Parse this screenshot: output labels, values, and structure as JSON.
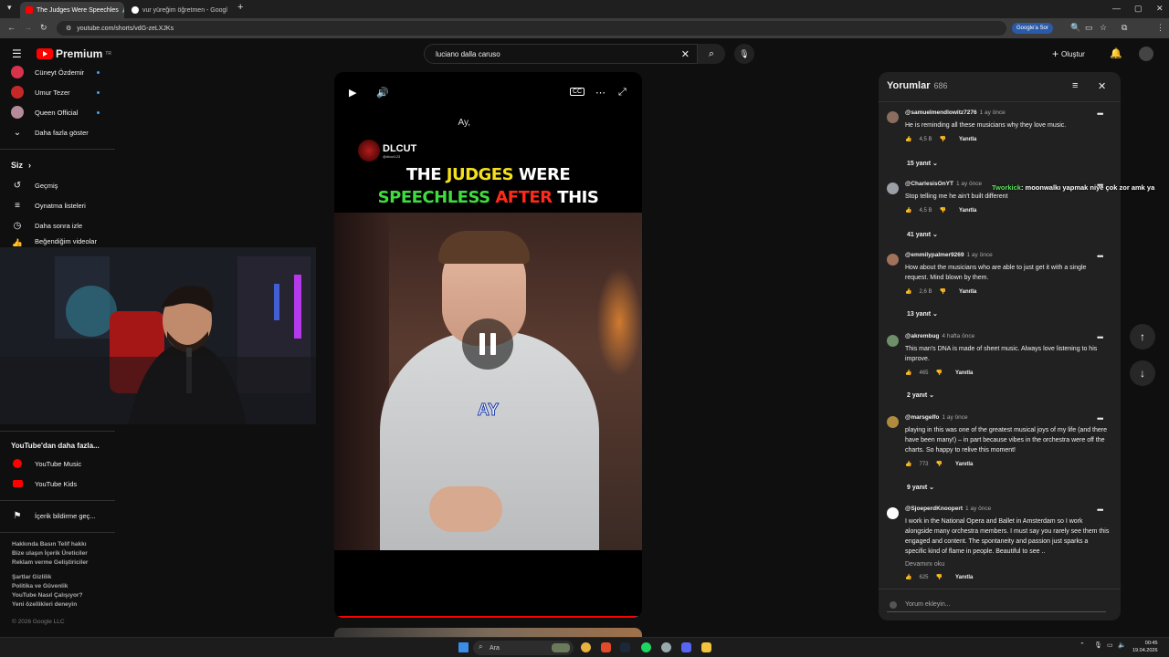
{
  "browser": {
    "tabs": [
      {
        "title": "The Judges Were Speechles",
        "active": true
      },
      {
        "title": "vur yüreğim öğretmen - Googl",
        "active": false
      }
    ],
    "url": "youtube.com/shorts/vdG-zeLXJKs",
    "google_ask": "Google'a Sor",
    "profile_letter": "B"
  },
  "header": {
    "logo_text": "Premium",
    "logo_sup": "TR",
    "search_value": "luciano dalla caruso",
    "create_label": "Oluştur"
  },
  "sidebar": {
    "subscriptions": [
      {
        "label": "Cüneyt Özdemir",
        "color": "#d6334c"
      },
      {
        "label": "Umur Tezer",
        "color": "#c62828"
      },
      {
        "label": "Queen Official",
        "color": "#b58a9a"
      }
    ],
    "show_more": "Daha fazla göster",
    "you_section": "Siz",
    "you_items": [
      "Geçmiş",
      "Oynatma listeleri",
      "Daha sonra izle",
      "Beğendiğim videolar"
    ],
    "more_from_youtube": "YouTube'dan daha fazla...",
    "yt_apps": [
      "YouTube Music",
      "YouTube Kids"
    ],
    "report": "İçerik bildirme geç...",
    "footer1": "Hakkında  Basın  Telif hakkı",
    "footer2": "Bize ulaşın  İçerik Üreticiler",
    "footer3": "Reklam verme  Geliştiriciler",
    "footer4": "Şartlar  Gizlilik",
    "footer5": "Politika ve Güvenlik",
    "footer6": "YouTube Nasıl Çalışıyor?",
    "footer7": "Yeni özellikleri deneyin",
    "copyright": "© 2026 Google LLC"
  },
  "video": {
    "subtitle_top": "Ay,",
    "brand_name": "DLCUT",
    "brand_handle": "@dlcut123",
    "title_line1": [
      {
        "text": "THE ",
        "color": "#ffffff"
      },
      {
        "text": "JUDGES ",
        "color": "#f4e01c"
      },
      {
        "text": "WERE",
        "color": "#ffffff"
      }
    ],
    "title_line2": [
      {
        "text": "SPEECHLESS ",
        "color": "#3fdc3f"
      },
      {
        "text": "AFTER ",
        "color": "#ff2a1a"
      },
      {
        "text": "THIS",
        "color": "#ffffff"
      }
    ],
    "caption": "AY",
    "progress": 0.98
  },
  "comments": {
    "title": "Yorumlar",
    "count": "686",
    "reply_label": "Yanıtla",
    "items": [
      {
        "author": "@samuelmendlowitz7276",
        "time": "1 ay önce",
        "text": "He is reminding all these musicians why they love music.",
        "likes": "4,5 B",
        "replies": "15 yanıt",
        "color": "#8a6d5e"
      },
      {
        "author": "@CharlesisOnYT",
        "time": "1 ay önce",
        "text": "Stop telling me he ain't built different",
        "likes": "4,5 B",
        "replies": "41 yanıt",
        "color": "#9aa0a6"
      },
      {
        "author": "@emmilypalmer9269",
        "time": "1 ay önce",
        "text": "How about the musicians who are able to just get it with a single request. Mind blown by them.",
        "likes": "2,6 B",
        "replies": "13 yanıt",
        "color": "#a0725a"
      },
      {
        "author": "@akrembug",
        "time": "4 hafta önce",
        "text": "This man's DNA is made of sheet music. Always love listening to his improve.",
        "likes": "465",
        "replies": "2 yanıt",
        "color": "#6f8f6a"
      },
      {
        "author": "@marsgelfo",
        "time": "1 ay önce",
        "text": "playing in this was one of the greatest musical joys of my life (and there have been many!) – in part because vibes in the orchestra were off the charts. So happy to relive this moment!",
        "likes": "773",
        "replies": "9 yanıt",
        "color": "#b08a3e"
      },
      {
        "author": "@SjoeperdKnoopert",
        "time": "1 ay önce",
        "text": "I work in the National Opera and Ballet in Amsterdam so I work alongside many orchestra members. I must say you rarely see them this engaged and content. The spontaneity and passion just sparks a specific kind of flame in people. Beautiful to see ..",
        "likes": "625",
        "read_more": "Devamını oku",
        "color": "#ffffff"
      }
    ],
    "add_placeholder": "Yorum ekleyin..."
  },
  "overlay": {
    "name": "Tworkick",
    "message": ": moonwalkı yapmak niye çok zor amk ya"
  },
  "taskbar": {
    "search": "Ara",
    "time": "00:45",
    "date": "19.04.2026"
  }
}
